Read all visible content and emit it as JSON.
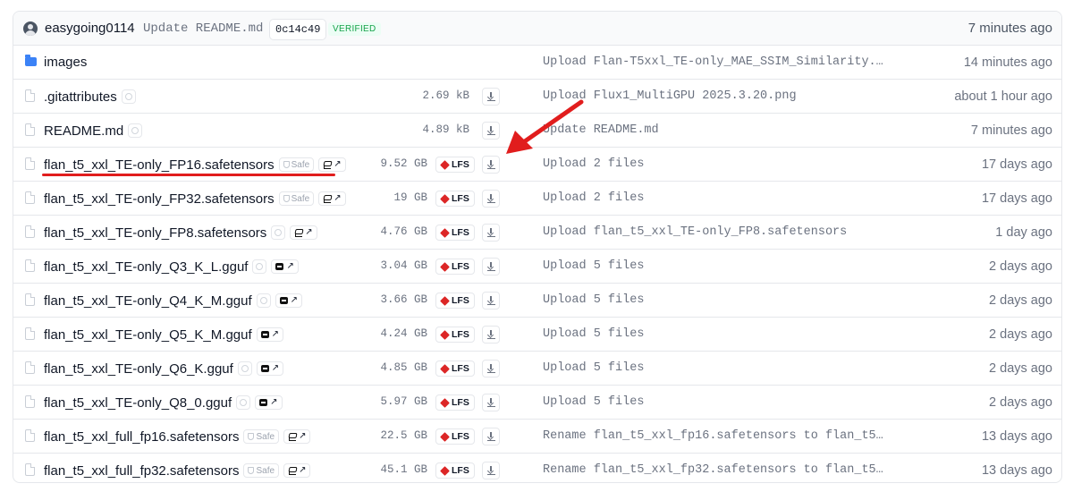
{
  "commit": {
    "author": "easygoing0114",
    "message": "Update README.md",
    "hash": "0c14c49",
    "verified": "VERIFIED",
    "time": "7 minutes ago"
  },
  "rows": [
    {
      "name": "images",
      "type": "folder",
      "size": "",
      "lfs": "",
      "commit": "Upload Flan-T5xxl_TE-only_MAE_SSIM_Similarity.…",
      "time": "14 minutes ago"
    },
    {
      "name": ".gitattributes",
      "type": "file",
      "size": "2.69 kB",
      "lfs": "",
      "commit": "Upload Flux1_MultiGPU 2025.3.20.png",
      "time": "about 1 hour ago"
    },
    {
      "name": "README.md",
      "type": "file",
      "size": "4.89 kB",
      "lfs": "",
      "commit": "Update README.md",
      "time": "7 minutes ago"
    },
    {
      "name": "flan_t5_xxl_TE-only_FP16.safetensors",
      "type": "file",
      "size": "9.52 GB",
      "lfs": "LFS",
      "safe": "Safe",
      "commit": "Upload 2 files",
      "time": "17 days ago"
    },
    {
      "name": "flan_t5_xxl_TE-only_FP32.safetensors",
      "type": "file",
      "size": "19 GB",
      "lfs": "LFS",
      "safe": "Safe",
      "commit": "Upload 2 files",
      "time": "17 days ago"
    },
    {
      "name": "flan_t5_xxl_TE-only_FP8.safetensors",
      "type": "file",
      "size": "4.76 GB",
      "lfs": "LFS",
      "commit": "Upload flan_t5_xxl_TE-only_FP8.safetensors",
      "time": "1 day ago"
    },
    {
      "name": "flan_t5_xxl_TE-only_Q3_K_L.gguf",
      "type": "file",
      "size": "3.04 GB",
      "lfs": "LFS",
      "commit": "Upload 5 files",
      "time": "2 days ago"
    },
    {
      "name": "flan_t5_xxl_TE-only_Q4_K_M.gguf",
      "type": "file",
      "size": "3.66 GB",
      "lfs": "LFS",
      "commit": "Upload 5 files",
      "time": "2 days ago"
    },
    {
      "name": "flan_t5_xxl_TE-only_Q5_K_M.gguf",
      "type": "file",
      "size": "4.24 GB",
      "lfs": "LFS",
      "commit": "Upload 5 files",
      "time": "2 days ago"
    },
    {
      "name": "flan_t5_xxl_TE-only_Q6_K.gguf",
      "type": "file",
      "size": "4.85 GB",
      "lfs": "LFS",
      "commit": "Upload 5 files",
      "time": "2 days ago"
    },
    {
      "name": "flan_t5_xxl_TE-only_Q8_0.gguf",
      "type": "file",
      "size": "5.97 GB",
      "lfs": "LFS",
      "commit": "Upload 5 files",
      "time": "2 days ago"
    },
    {
      "name": "flan_t5_xxl_full_fp16.safetensors",
      "type": "file",
      "size": "22.5 GB",
      "lfs": "LFS",
      "safe": "Safe",
      "commit": "Rename flan_t5_xxl_fp16.safetensors to flan_t5…",
      "time": "13 days ago"
    },
    {
      "name": "flan_t5_xxl_full_fp32.safetensors",
      "type": "file",
      "size": "45.1 GB",
      "lfs": "LFS",
      "safe": "Safe",
      "commit": "Rename flan_t5_xxl_fp32.safetensors to flan_t5…",
      "time": "13 days ago"
    }
  ],
  "annotation": {
    "color": "#e11d1d"
  }
}
